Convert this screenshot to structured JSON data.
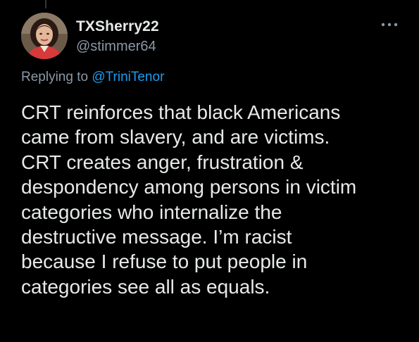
{
  "tweet": {
    "display_name": "TXSherry22",
    "handle": "@stimmer64",
    "replying_prefix": "Replying to",
    "replying_to": "@TriniTenor",
    "text": "CRT reinforces that black Americans\ncame from slavery, and are victims.\nCRT creates anger, frustration &\ndespondency among persons in victim\ncategories who internalize the\ndestructive message. I’m racist\nbecause I refuse to put people in\ncategories see all as equals.",
    "more_icon": "more-horizontal-icon",
    "avatar_icon": "profile-photo"
  },
  "colors": {
    "background": "#000000",
    "primary_text": "#e7e9ea",
    "secondary_text": "#8b98a5",
    "accent": "#1d9bf0"
  }
}
